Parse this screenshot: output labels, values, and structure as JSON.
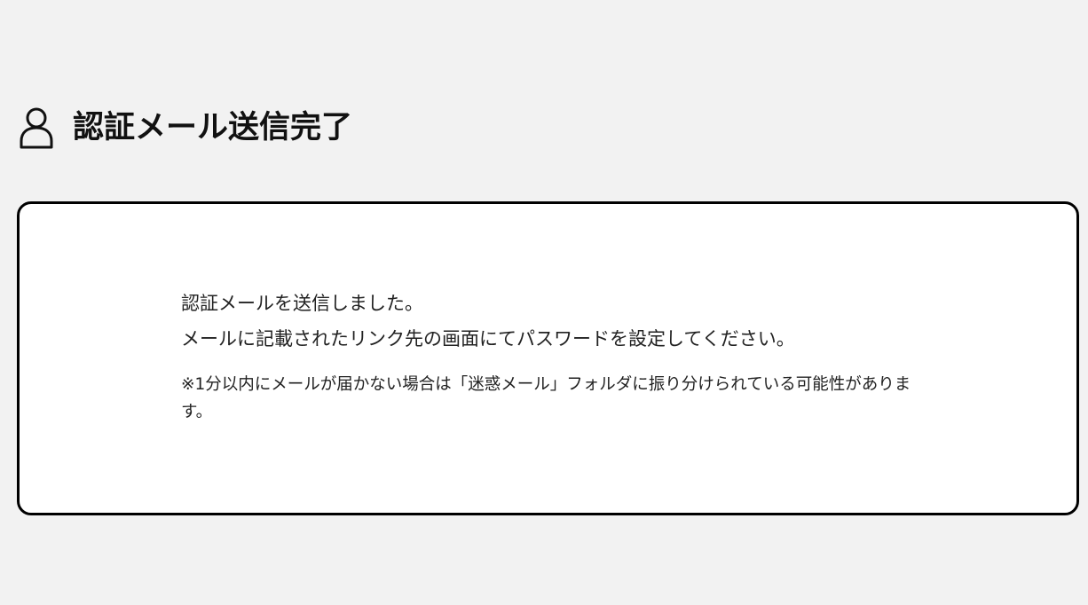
{
  "header": {
    "icon": "user-icon",
    "title": "認証メール送信完了"
  },
  "message": {
    "line1": "認証メールを送信しました。",
    "line2": "メールに記載されたリンク先の画面にてパスワードを設定してください。",
    "note": "※1分以内にメールが届かない場合は「迷惑メール」フォルダに振り分けられている可能性があります。"
  },
  "colors": {
    "background": "#f2f2f2",
    "card": "#ffffff",
    "border": "#000000",
    "text": "#222222"
  }
}
